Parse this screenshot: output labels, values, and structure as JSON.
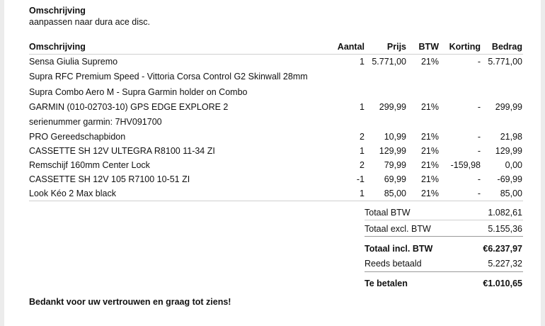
{
  "description": {
    "heading": "Omschrijving",
    "text": "aanpassen naar dura ace disc."
  },
  "table": {
    "headers": {
      "omschrijving": "Omschrijving",
      "aantal": "Aantal",
      "prijs": "Prijs",
      "btw": "BTW",
      "korting": "Korting",
      "bedrag": "Bedrag"
    },
    "rows": [
      {
        "omschrijving": "Sensa Giulia Supremo",
        "aantal": "1",
        "prijs": "5.771,00",
        "btw": "21%",
        "korting": "-",
        "bedrag": "5.771,00"
      },
      {
        "omschrijving": "Supra RFC Premium Speed - Vittoria Corsa Control G2 Skinwall 28mm",
        "aantal": "",
        "prijs": "",
        "btw": "",
        "korting": "",
        "bedrag": ""
      },
      {
        "omschrijving": "Supra Combo Aero M - Supra Garmin holder on Combo",
        "aantal": "",
        "prijs": "",
        "btw": "",
        "korting": "",
        "bedrag": ""
      },
      {
        "omschrijving": "GARMIN (010-02703-10) GPS EDGE EXPLORE 2",
        "aantal": "1",
        "prijs": "299,99",
        "btw": "21%",
        "korting": "-",
        "bedrag": "299,99"
      },
      {
        "omschrijving": "serienummer garmin: 7HV091700",
        "aantal": "",
        "prijs": "",
        "btw": "",
        "korting": "",
        "bedrag": ""
      },
      {
        "omschrijving": "PRO Gereedschapbidon",
        "aantal": "2",
        "prijs": "10,99",
        "btw": "21%",
        "korting": "-",
        "bedrag": "21,98"
      },
      {
        "omschrijving": "CASSETTE SH 12V ULTEGRA R8100 11-34 ZI",
        "aantal": "1",
        "prijs": "129,99",
        "btw": "21%",
        "korting": "-",
        "bedrag": "129,99"
      },
      {
        "omschrijving": "Remschijf 160mm Center Lock",
        "aantal": "2",
        "prijs": "79,99",
        "btw": "21%",
        "korting": "-159,98",
        "bedrag": "0,00"
      },
      {
        "omschrijving": "CASSETTE SH 12V 105 R7100 10-51 ZI",
        "aantal": "-1",
        "prijs": "69,99",
        "btw": "21%",
        "korting": "-",
        "bedrag": "-69,99"
      },
      {
        "omschrijving": "Look Kéo 2 Max black",
        "aantal": "1",
        "prijs": "85,00",
        "btw": "21%",
        "korting": "-",
        "bedrag": "85,00"
      }
    ]
  },
  "totals": {
    "totaal_btw": {
      "label": "Totaal BTW",
      "value": "1.082,61"
    },
    "totaal_excl": {
      "label": "Totaal excl. BTW",
      "value": "5.155,36"
    },
    "totaal_incl": {
      "label": "Totaal incl. BTW",
      "value": "€6.237,97"
    },
    "reeds_betaald": {
      "label": "Reeds betaald",
      "value": "5.227,32"
    },
    "te_betalen": {
      "label": "Te betalen",
      "value": "€1.010,65"
    }
  },
  "footer": {
    "thanks": "Bedankt voor uw vertrouwen en graag tot ziens!"
  }
}
